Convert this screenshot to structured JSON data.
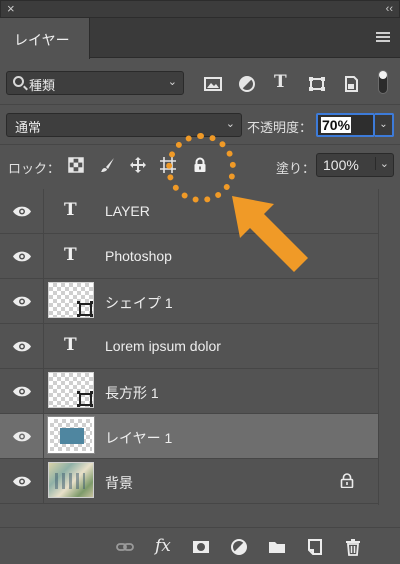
{
  "window": {
    "close_glyph": "×",
    "collapse_glyph": "‹‹"
  },
  "panel": {
    "tab_label": "レイヤー",
    "menu_icon": "hamburger-icon"
  },
  "filter": {
    "kind_label": "種類",
    "kind_icon": "search-icon",
    "chevron": "⌄",
    "filter_icons": [
      "image-filter-icon",
      "adjustment-filter-icon",
      "type-filter-icon",
      "shape-filter-icon",
      "smart-object-filter-icon"
    ],
    "type_glyph": "T"
  },
  "blend": {
    "mode_label": "通常",
    "chevron": "⌄",
    "opacity_label": "不透明度：",
    "opacity_value": "70%",
    "opacity_chevron": "⌄"
  },
  "lock": {
    "label": "ロック：",
    "icons": [
      "lock-transparent-pixels-icon",
      "lock-image-pixels-icon",
      "lock-position-icon",
      "lock-artboard-icon",
      "lock-all-icon"
    ],
    "fill_label": "塗り：",
    "fill_value": "100%",
    "fill_chevron": "⌄"
  },
  "layers": [
    {
      "name": "LAYER",
      "kind": "type",
      "type_glyph": "T",
      "selected": false,
      "locked": false
    },
    {
      "name": "Photoshop",
      "kind": "type",
      "type_glyph": "T",
      "selected": false,
      "locked": false
    },
    {
      "name": "シェイプ 1",
      "kind": "shape",
      "selected": false,
      "locked": false
    },
    {
      "name": "Lorem ipsum dolor",
      "kind": "type",
      "type_glyph": "T",
      "selected": false,
      "locked": false
    },
    {
      "name": "長方形 1",
      "kind": "shape",
      "selected": false,
      "locked": false
    },
    {
      "name": "レイヤー 1",
      "kind": "pixel",
      "selected": true,
      "locked": false
    },
    {
      "name": "背景",
      "kind": "background",
      "selected": false,
      "locked": true
    }
  ],
  "bottom_bar": {
    "icons": [
      "link-layers-icon",
      "fx-icon",
      "mask-icon",
      "adjustment-layer-icon",
      "group-folder-icon",
      "new-layer-icon",
      "trash-icon"
    ],
    "fx_label": "fx"
  },
  "annotation": {
    "color": "#f09a27"
  },
  "colors": {
    "panel_bg": "#535353",
    "selected_row": "#6e6e6e",
    "focus_blue": "#3d7bd9"
  }
}
